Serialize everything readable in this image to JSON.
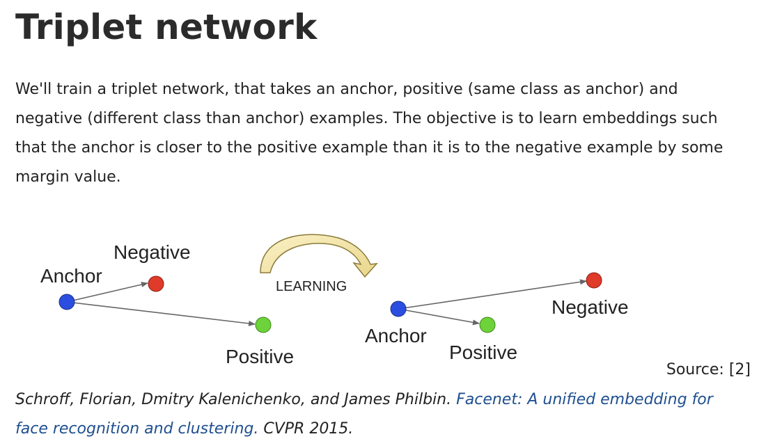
{
  "page": {
    "title": "Triplet network",
    "paragraph_lines": [
      "We'll train a triplet network, that takes an anchor, positive (same class as anchor) and",
      "negative (different class than anchor) examples. The objective is to learn embeddings such",
      "that the anchor is closer to the positive example than it is to the negative example by some",
      "margin value."
    ]
  },
  "figure": {
    "before": {
      "anchor_label": "Anchor",
      "negative_label": "Negative",
      "positive_label": "Positive"
    },
    "arrow_label": "LEARNING",
    "after": {
      "anchor_label": "Anchor",
      "negative_label": "Negative",
      "positive_label": "Positive"
    },
    "colors": {
      "anchor": "#2b4ee0",
      "negative": "#e03a2a",
      "positive": "#6ed33a",
      "arrow_fill": "#f2e3a6",
      "edge": "#666666"
    }
  },
  "source": "Source: [2]",
  "citation": {
    "authors": "Schroff, Florian, Dmitry Kalenichenko, and James Philbin.",
    "link_line1": "Facenet: A unified embedding for",
    "link_line2": "face recognition and clustering.",
    "venue": "CVPR 2015."
  }
}
